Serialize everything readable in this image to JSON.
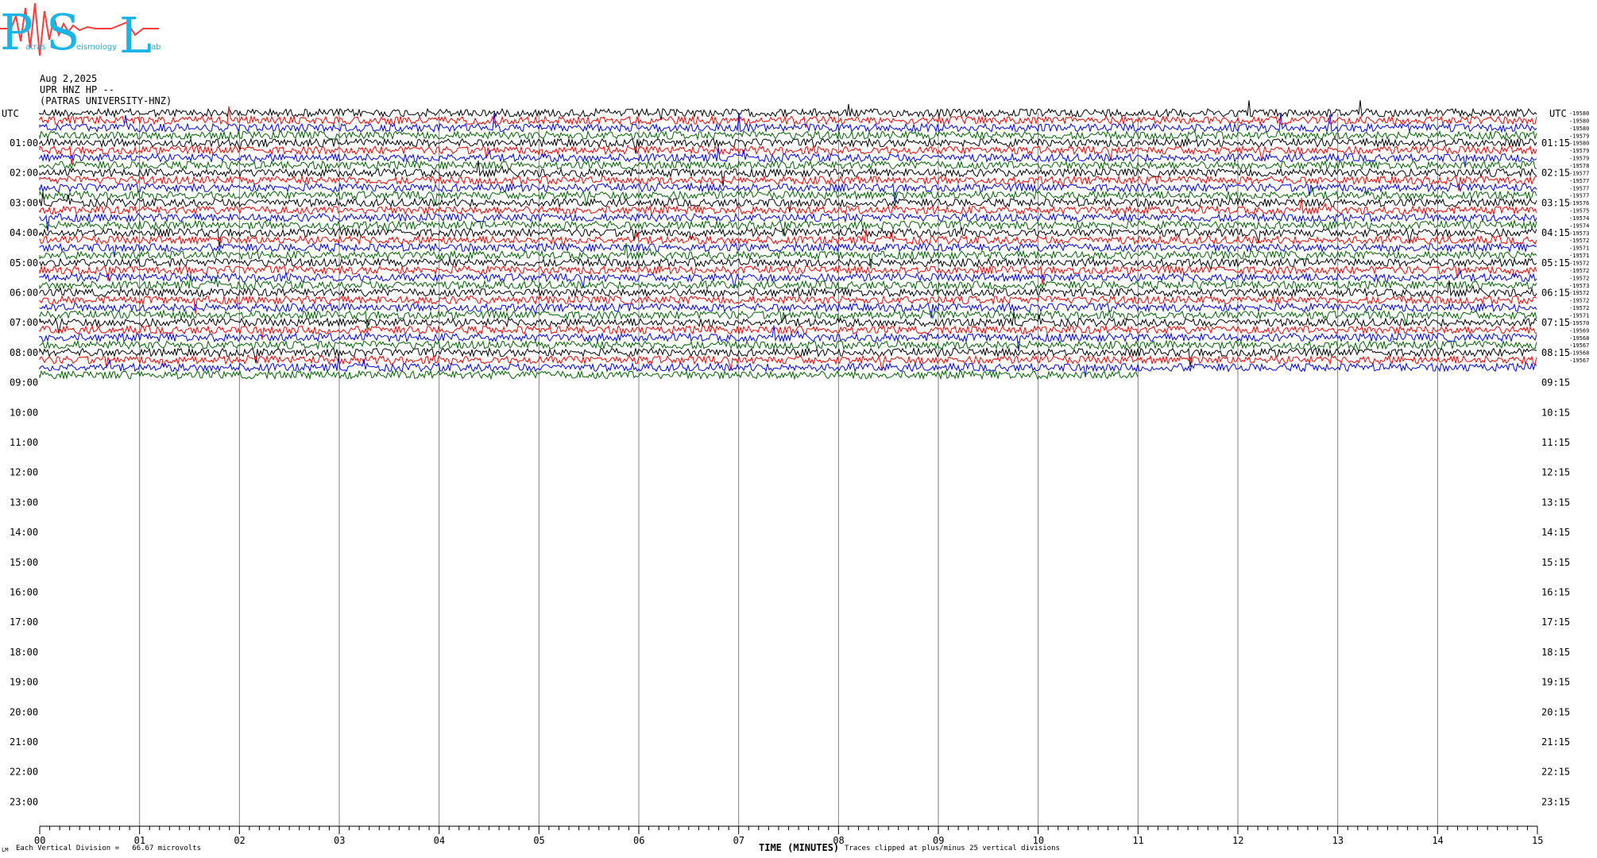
{
  "logo": {
    "letters": "PSL",
    "subtitle_words": [
      "atras",
      "eismology",
      "ab"
    ],
    "colors": {
      "text": "#19b5e6",
      "wave": "#ff3b3b"
    }
  },
  "header": {
    "date": "Aug 2,2025",
    "station": "UPR HNZ HP --",
    "org": "(PATRAS UNIVERSITY-HNZ)"
  },
  "footer": {
    "scale_text": "Each Vertical Division =   66.67 microvolts",
    "clip_text": "Traces clipped at plus/minus 25 vertical divisions",
    "corner_mark": "LM"
  },
  "chart_data": {
    "type": "line",
    "title": "",
    "xlabel": "TIME (MINUTES)",
    "left_axis_title": "UTC",
    "right_axis_title": "UTC",
    "xlim": [
      0,
      15
    ],
    "x_ticks": [
      "00",
      "01",
      "02",
      "03",
      "04",
      "05",
      "06",
      "07",
      "08",
      "09",
      "10",
      "11",
      "12",
      "13",
      "14",
      "15"
    ],
    "left_hour_labels": [
      "01:00",
      "02:00",
      "03:00",
      "04:00",
      "05:00",
      "06:00",
      "07:00",
      "08:00",
      "09:00",
      "10:00",
      "11:00",
      "12:00",
      "13:00",
      "14:00",
      "15:00",
      "16:00",
      "17:00",
      "18:00",
      "19:00",
      "20:00",
      "21:00",
      "22:00",
      "23:00"
    ],
    "right_hour_labels": [
      "01:15",
      "02:15",
      "03:15",
      "04:15",
      "05:15",
      "06:15",
      "07:15",
      "08:15",
      "09:15",
      "10:15",
      "11:15",
      "12:15",
      "13:15",
      "14:15",
      "15:15",
      "16:15",
      "17:15",
      "18:15",
      "19:15",
      "20:15",
      "21:15",
      "22:15",
      "23:15"
    ],
    "trace_colors": [
      "#000000",
      "#ff0000",
      "#0000ff",
      "#006600"
    ],
    "trace_count": 36,
    "last_trace_end_minute": 11,
    "right_counts": [
      "-19580",
      "-19580",
      "-19580",
      "-19579",
      "-19580",
      "-19579",
      "-19579",
      "-19578",
      "-19577",
      "-19577",
      "-19577",
      "-19577",
      "-19576",
      "-19575",
      "-19574",
      "-19574",
      "-19573",
      "-19572",
      "-19571",
      "-19571",
      "-19572",
      "-19572",
      "-19572",
      "-19573",
      "-19572",
      "-19572",
      "-19572",
      "-19571",
      "-19570",
      "-19569",
      "-19568",
      "-19567",
      "-19568",
      "-19567"
    ]
  }
}
